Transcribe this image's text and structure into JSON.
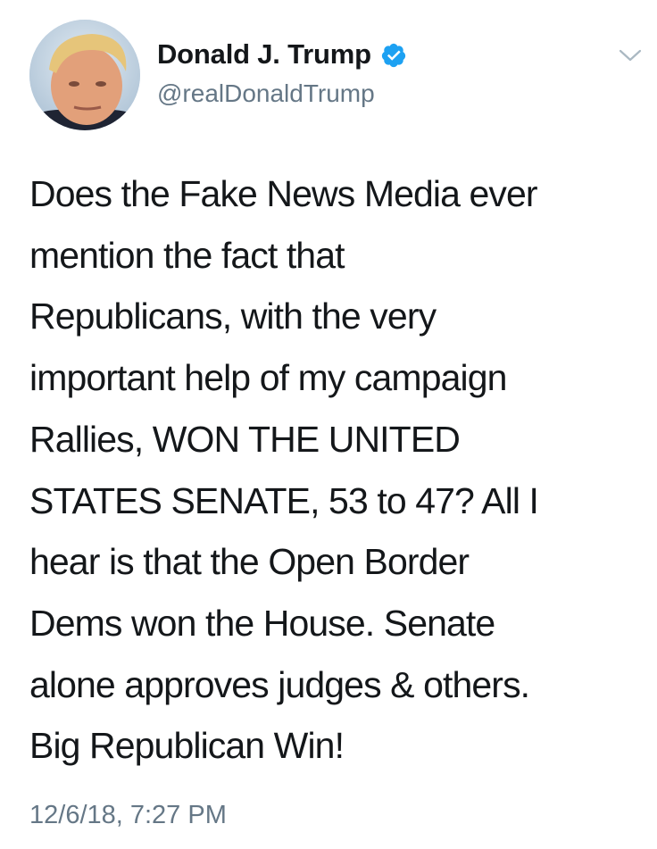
{
  "author": {
    "display_name": "Donald J. Trump",
    "handle": "@realDonaldTrump",
    "verified": true,
    "verified_color": "#1da1f2"
  },
  "tweet": {
    "text": "Does the Fake News Media ever\nmention the fact that\nRepublicans, with the very\nimportant help of my campaign\nRallies, WON THE UNITED\nSTATES SENATE, 53 to 47? All I\nhear is that the Open Border\nDems won the House. Senate\nalone approves judges & others.\nBig Republican Win!",
    "timestamp": "12/6/18, 7:27 PM"
  },
  "icons": {
    "verified": "verified-badge-icon",
    "menu": "chevron-down-icon"
  },
  "colors": {
    "text_primary": "#14171a",
    "text_secondary": "#657786",
    "accent": "#1da1f2"
  }
}
